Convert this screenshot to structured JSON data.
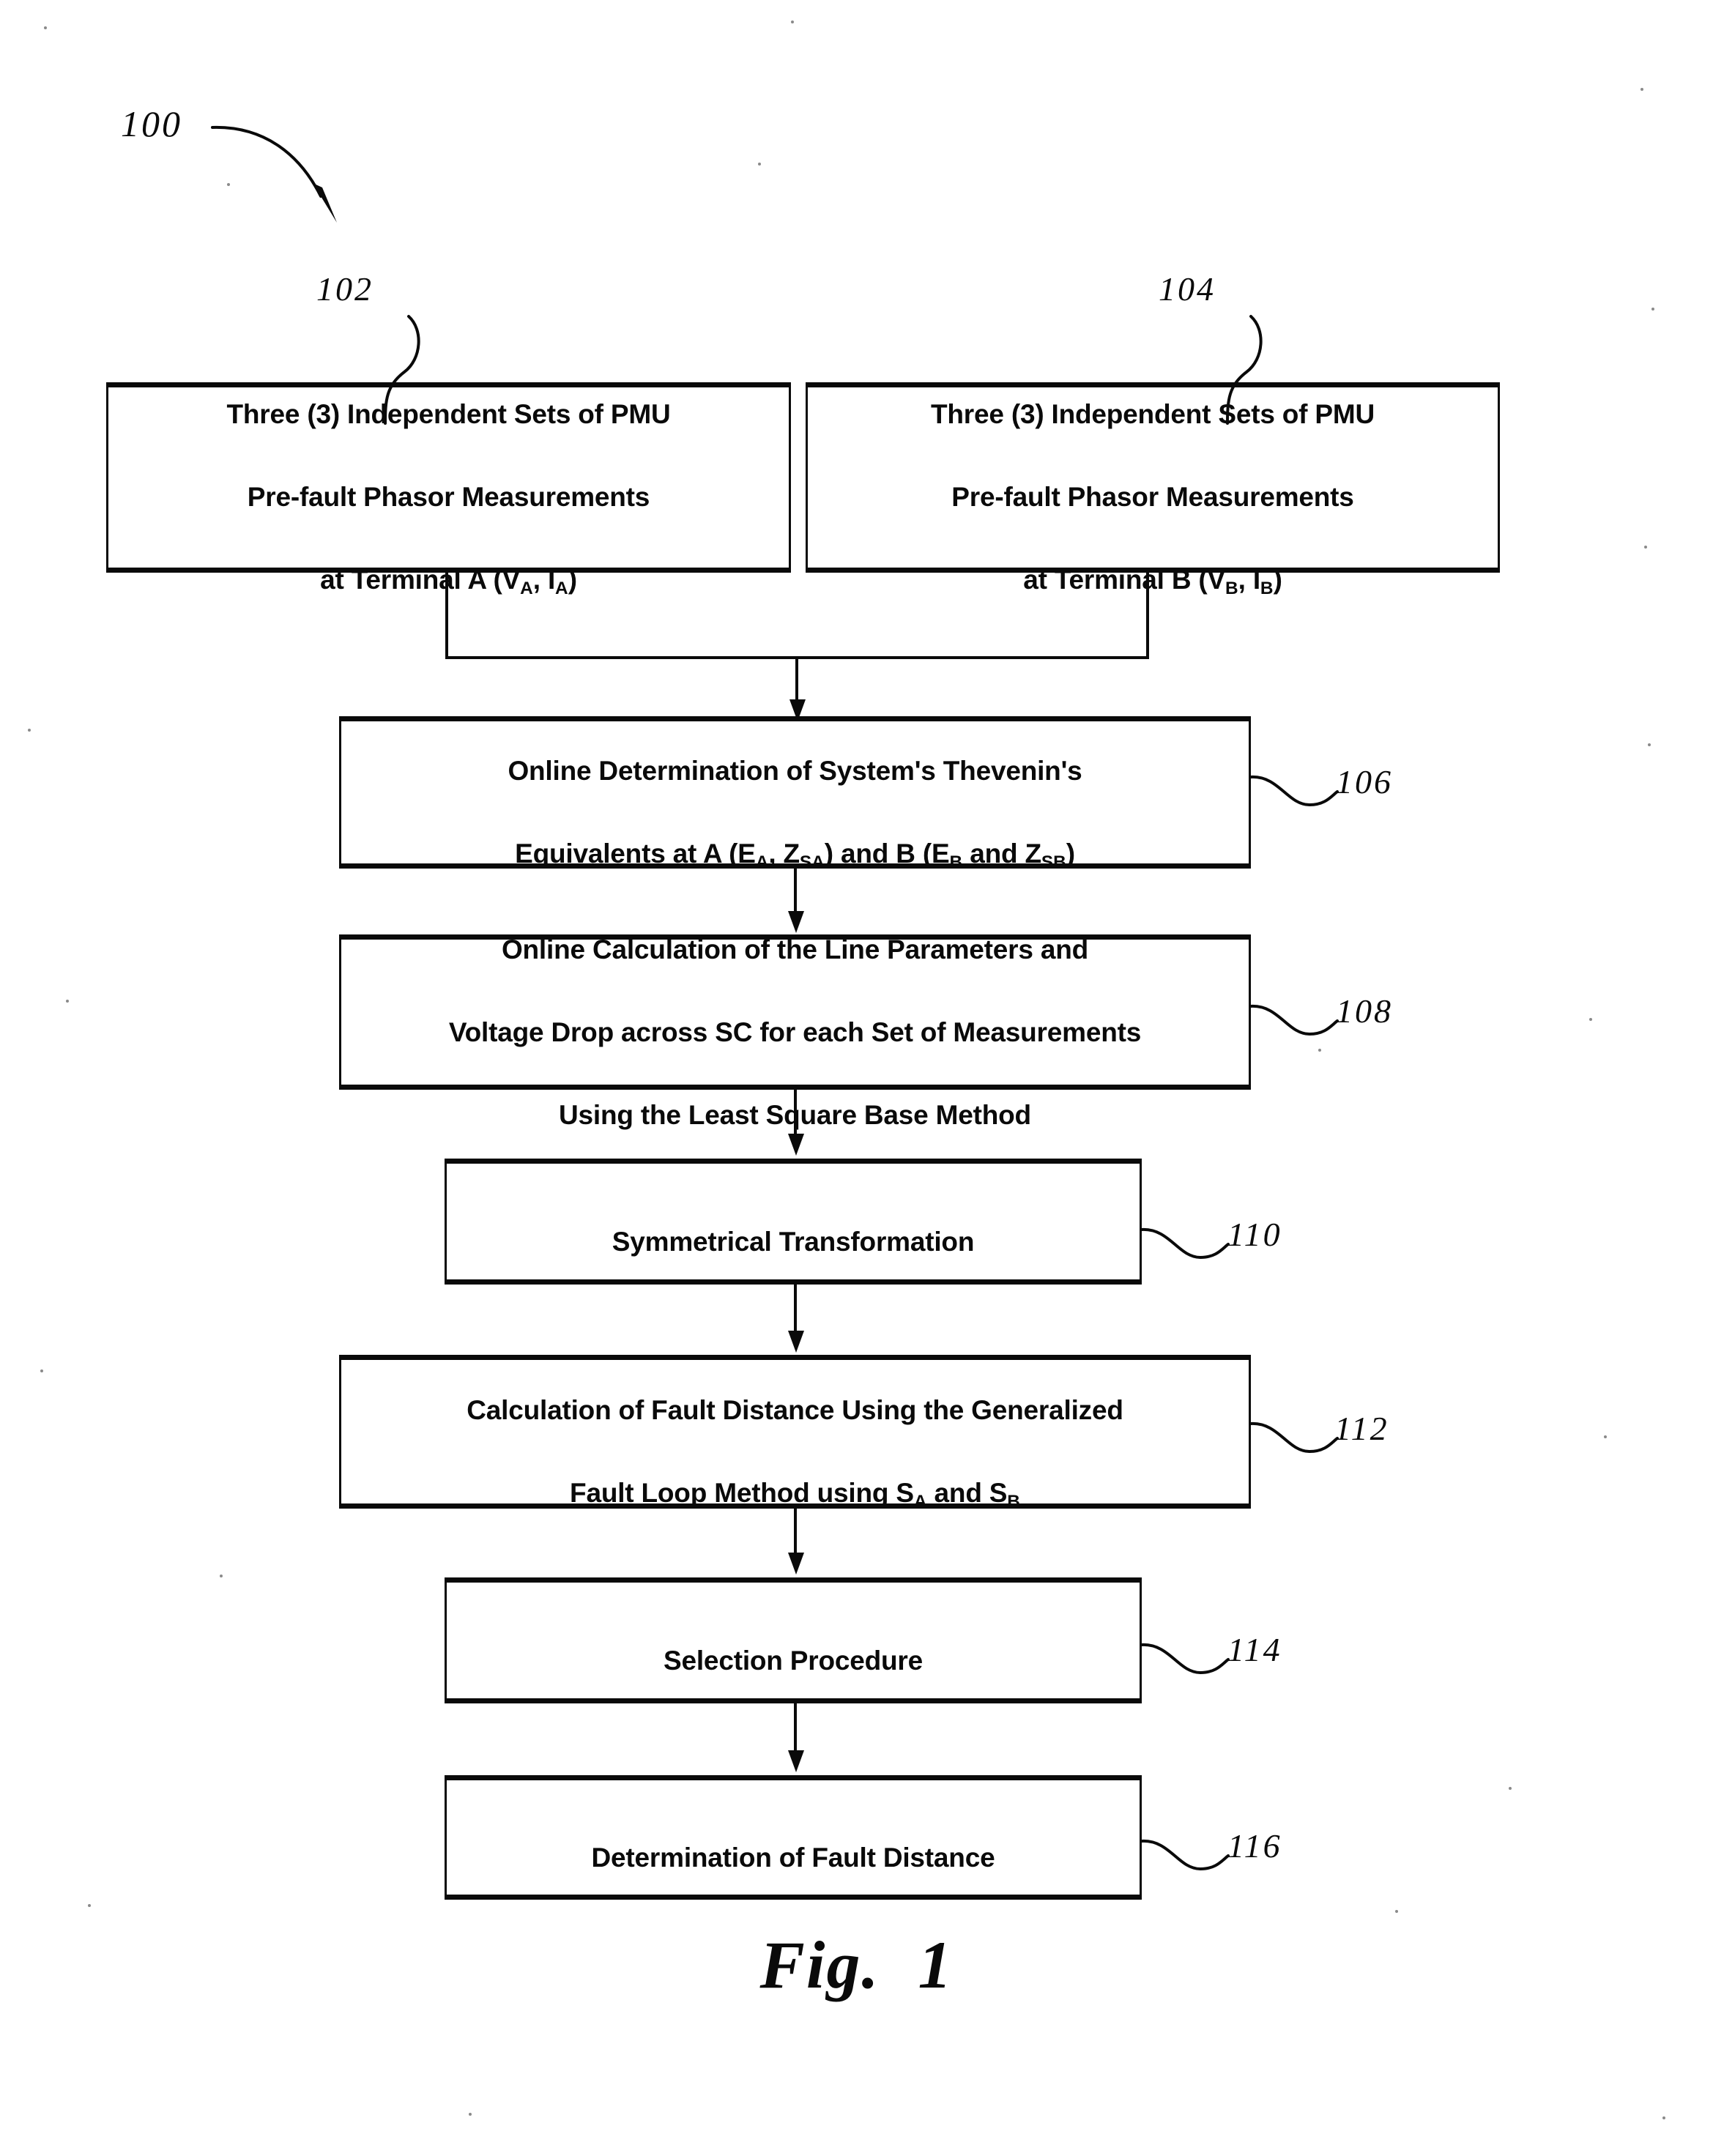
{
  "figure": {
    "caption_label": "Fig.",
    "caption_number": "1",
    "diagram_ref": "100"
  },
  "nodes": [
    {
      "ref": "102",
      "name": "pmu-measurements-terminal-a",
      "lines": [
        "Three (3) Independent Sets of PMU",
        "Pre-fault Phasor Measurements",
        "at Terminal A (V",
        "A",
        ", I",
        "A",
        ")"
      ],
      "line1": "Three (3) Independent Sets of PMU",
      "line2": "Pre-fault Phasor Measurements",
      "line3_pre": "at Terminal A (V",
      "line3_sub1": "A",
      "line3_mid": ", I",
      "line3_sub2": "A",
      "line3_post": ")"
    },
    {
      "ref": "104",
      "name": "pmu-measurements-terminal-b",
      "line1": "Three (3) Independent Sets of PMU",
      "line2": "Pre-fault Phasor Measurements",
      "line3_pre": "at Terminal B (V",
      "line3_sub1": "B",
      "line3_mid": ", I",
      "line3_sub2": "B",
      "line3_post": ")"
    },
    {
      "ref": "106",
      "name": "thevenin-equivalents-determination",
      "line1": "Online Determination of System's Thevenin's",
      "line2_pre": "Equivalents at A (E",
      "line2_sub1": "A",
      "line2_mid1": ", Z",
      "line2_sub2": "SA",
      "line2_mid2": ") and B (E",
      "line2_sub3": "B",
      "line2_mid3": " and Z",
      "line2_sub4": "SB",
      "line2_post": ")"
    },
    {
      "ref": "108",
      "name": "line-parameters-calculation",
      "line1": "Online Calculation of the Line Parameters and",
      "line2": "Voltage Drop across SC for each Set of  Measurements",
      "line3": "Using the Least Square Base Method"
    },
    {
      "ref": "110",
      "name": "symmetrical-transformation",
      "line1": "Symmetrical Transformation"
    },
    {
      "ref": "112",
      "name": "fault-distance-calculation",
      "line1": "Calculation of Fault Distance Using the Generalized",
      "line2_pre": "Fault Loop Method using  S",
      "line2_sub1": "A",
      "line2_mid": "  and S",
      "line2_sub2": "B"
    },
    {
      "ref": "114",
      "name": "selection-procedure",
      "line1": "Selection Procedure"
    },
    {
      "ref": "116",
      "name": "fault-distance-determination",
      "line1": "Determination of Fault Distance"
    }
  ],
  "colors": {
    "ink": "#0a0a0a",
    "paper": "#ffffff"
  }
}
